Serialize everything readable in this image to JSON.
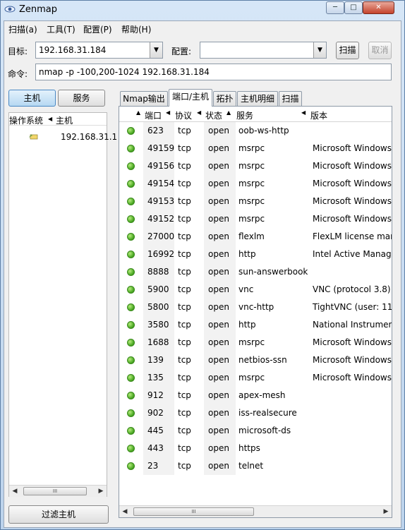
{
  "window": {
    "title": "Zenmap",
    "min_glyph": "─",
    "max_glyph": "□",
    "close_glyph": "✕"
  },
  "menu": [
    "扫描(a)",
    "工具(T)",
    "配置(P)",
    "帮助(H)"
  ],
  "toolbar": {
    "target_label": "目标:",
    "target_value": "192.168.31.184",
    "profile_label": "配置:",
    "profile_value": "",
    "scan_button": "扫描",
    "cancel_button": "取消",
    "command_label": "命令:",
    "command_value": "nmap -p -100,200-1024 192.168.31.184"
  },
  "left": {
    "hosts_button": "主机",
    "services_button": "服务",
    "col_os": "操作系统",
    "col_host": "主机",
    "host_ip": "192.168.31.1",
    "filter_button": "过滤主机"
  },
  "tabs": [
    "Nmap输出",
    "端口/主机",
    "拓扑",
    "主机明细",
    "扫描"
  ],
  "active_tab": 1,
  "ports_table": {
    "headers": {
      "port": "端口",
      "protocol": "协议",
      "state": "状态",
      "service": "服务",
      "version": "版本"
    },
    "rows": [
      {
        "port": "623",
        "protocol": "tcp",
        "state": "open",
        "service": "oob-ws-http",
        "version": ""
      },
      {
        "port": "49159",
        "protocol": "tcp",
        "state": "open",
        "service": "msrpc",
        "version": "Microsoft Windows"
      },
      {
        "port": "49156",
        "protocol": "tcp",
        "state": "open",
        "service": "msrpc",
        "version": "Microsoft Windows"
      },
      {
        "port": "49154",
        "protocol": "tcp",
        "state": "open",
        "service": "msrpc",
        "version": "Microsoft Windows"
      },
      {
        "port": "49153",
        "protocol": "tcp",
        "state": "open",
        "service": "msrpc",
        "version": "Microsoft Windows"
      },
      {
        "port": "49152",
        "protocol": "tcp",
        "state": "open",
        "service": "msrpc",
        "version": "Microsoft Windows"
      },
      {
        "port": "27000",
        "protocol": "tcp",
        "state": "open",
        "service": "flexlm",
        "version": "FlexLM license mar"
      },
      {
        "port": "16992",
        "protocol": "tcp",
        "state": "open",
        "service": "http",
        "version": "Intel Active Manage"
      },
      {
        "port": "8888",
        "protocol": "tcp",
        "state": "open",
        "service": "sun-answerbook",
        "version": ""
      },
      {
        "port": "5900",
        "protocol": "tcp",
        "state": "open",
        "service": "vnc",
        "version": "VNC (protocol 3.8)"
      },
      {
        "port": "5800",
        "protocol": "tcp",
        "state": "open",
        "service": "vnc-http",
        "version": "TightVNC (user: 11"
      },
      {
        "port": "3580",
        "protocol": "tcp",
        "state": "open",
        "service": "http",
        "version": "National Instrumen"
      },
      {
        "port": "1688",
        "protocol": "tcp",
        "state": "open",
        "service": "msrpc",
        "version": "Microsoft Windows"
      },
      {
        "port": "139",
        "protocol": "tcp",
        "state": "open",
        "service": "netbios-ssn",
        "version": "Microsoft Windows"
      },
      {
        "port": "135",
        "protocol": "tcp",
        "state": "open",
        "service": "msrpc",
        "version": "Microsoft Windows"
      },
      {
        "port": "912",
        "protocol": "tcp",
        "state": "open",
        "service": "apex-mesh",
        "version": ""
      },
      {
        "port": "902",
        "protocol": "tcp",
        "state": "open",
        "service": "iss-realsecure",
        "version": ""
      },
      {
        "port": "445",
        "protocol": "tcp",
        "state": "open",
        "service": "microsoft-ds",
        "version": ""
      },
      {
        "port": "443",
        "protocol": "tcp",
        "state": "open",
        "service": "https",
        "version": ""
      },
      {
        "port": "23",
        "protocol": "tcp",
        "state": "open",
        "service": "telnet",
        "version": ""
      }
    ]
  },
  "scrollbar": {
    "thumb_grip": "III",
    "left_arrow": "◀",
    "right_arrow": "▶"
  },
  "colors": {
    "open_state": "#49a722",
    "title_bar": "#d6e6f7",
    "close_button": "#c4432c"
  }
}
